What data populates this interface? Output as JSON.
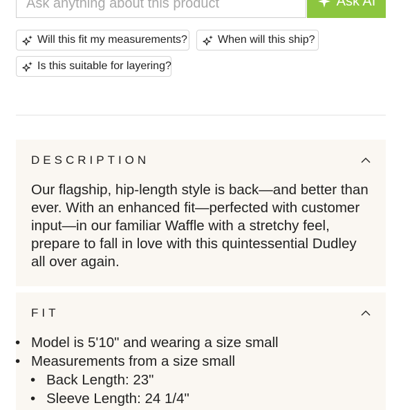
{
  "ask": {
    "placeholder": "Ask anything about this product",
    "button_label": "Ask AI",
    "button_color": "#8cc63f"
  },
  "suggestions": [
    {
      "label": "Will this fit my measurements?",
      "icon": "sparkle-icon"
    },
    {
      "label": "When will this ship?",
      "icon": "sparkle-icon"
    },
    {
      "label": "Is this suitable for layering?",
      "icon": "sparkle-icon"
    }
  ],
  "description": {
    "title": "DESCRIPTION",
    "expanded": true,
    "icon": "chevron-up-icon",
    "text": "Our flagship, hip-length style is back—and better than ever. With an enhanced fit—perfected with customer input—in our familiar Waffle with a stretchy feel, prepare to fall in love with this quintessential Dudley all over again."
  },
  "fit": {
    "title": "FIT",
    "expanded": true,
    "icon": "chevron-up-icon",
    "items": [
      "Model is 5'10\" and wearing a size small",
      "Measurements from a size small"
    ],
    "sub_items": [
      "Back Length: 23\"",
      "Sleeve Length: 24 1/4\""
    ]
  },
  "colors": {
    "section_background": "#faf7f2",
    "text": "#222222"
  }
}
